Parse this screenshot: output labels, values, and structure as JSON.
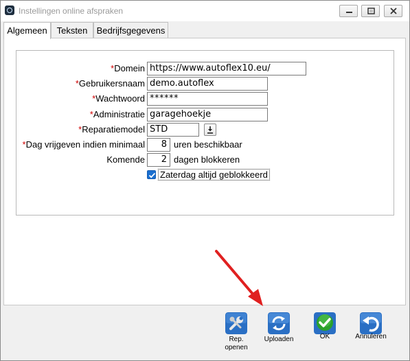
{
  "window": {
    "title": "Instellingen online afspraken"
  },
  "tabs": [
    {
      "label": "Algemeen",
      "active": true
    },
    {
      "label": "Teksten",
      "active": false
    },
    {
      "label": "Bedrijfsgegevens",
      "active": false
    }
  ],
  "form": {
    "required_marker": "*",
    "domein": {
      "label": "Domein",
      "value": "https://www.autoflex10.eu/"
    },
    "gebruikersnaam": {
      "label": "Gebruikersnaam",
      "value": "demo.autoflex"
    },
    "wachtwoord": {
      "label": "Wachtwoord",
      "value": "******"
    },
    "administratie": {
      "label": "Administratie",
      "value": "garagehoekje"
    },
    "reparatiemodel": {
      "label": "Reparatiemodel",
      "value": "STD"
    },
    "dag_vrijgeven": {
      "label": "Dag vrijgeven indien minimaal",
      "value": "8",
      "suffix": "uren beschikbaar"
    },
    "komende": {
      "label": "Komende",
      "value": "2",
      "suffix": "dagen blokkeren"
    },
    "zaterdag": {
      "label": "Zaterdag altijd geblokkeerd",
      "checked": true
    }
  },
  "toolbar": {
    "rep_openen": {
      "label": "Rep.\nopenen",
      "line1": "Rep.",
      "line2": "openen",
      "icon": "wrench-icon"
    },
    "uploaden": {
      "label": "Uploaden",
      "icon": "refresh-icon"
    },
    "ok": {
      "label": "OK",
      "icon": "checkmark-icon"
    },
    "annuleren": {
      "label": "Annuleren",
      "icon": "undo-icon"
    }
  },
  "colors": {
    "accent_blue": "#2a6fc4",
    "ok_green": "#2aa12a",
    "arrow_red": "#e02020",
    "required_red": "#d00000"
  }
}
